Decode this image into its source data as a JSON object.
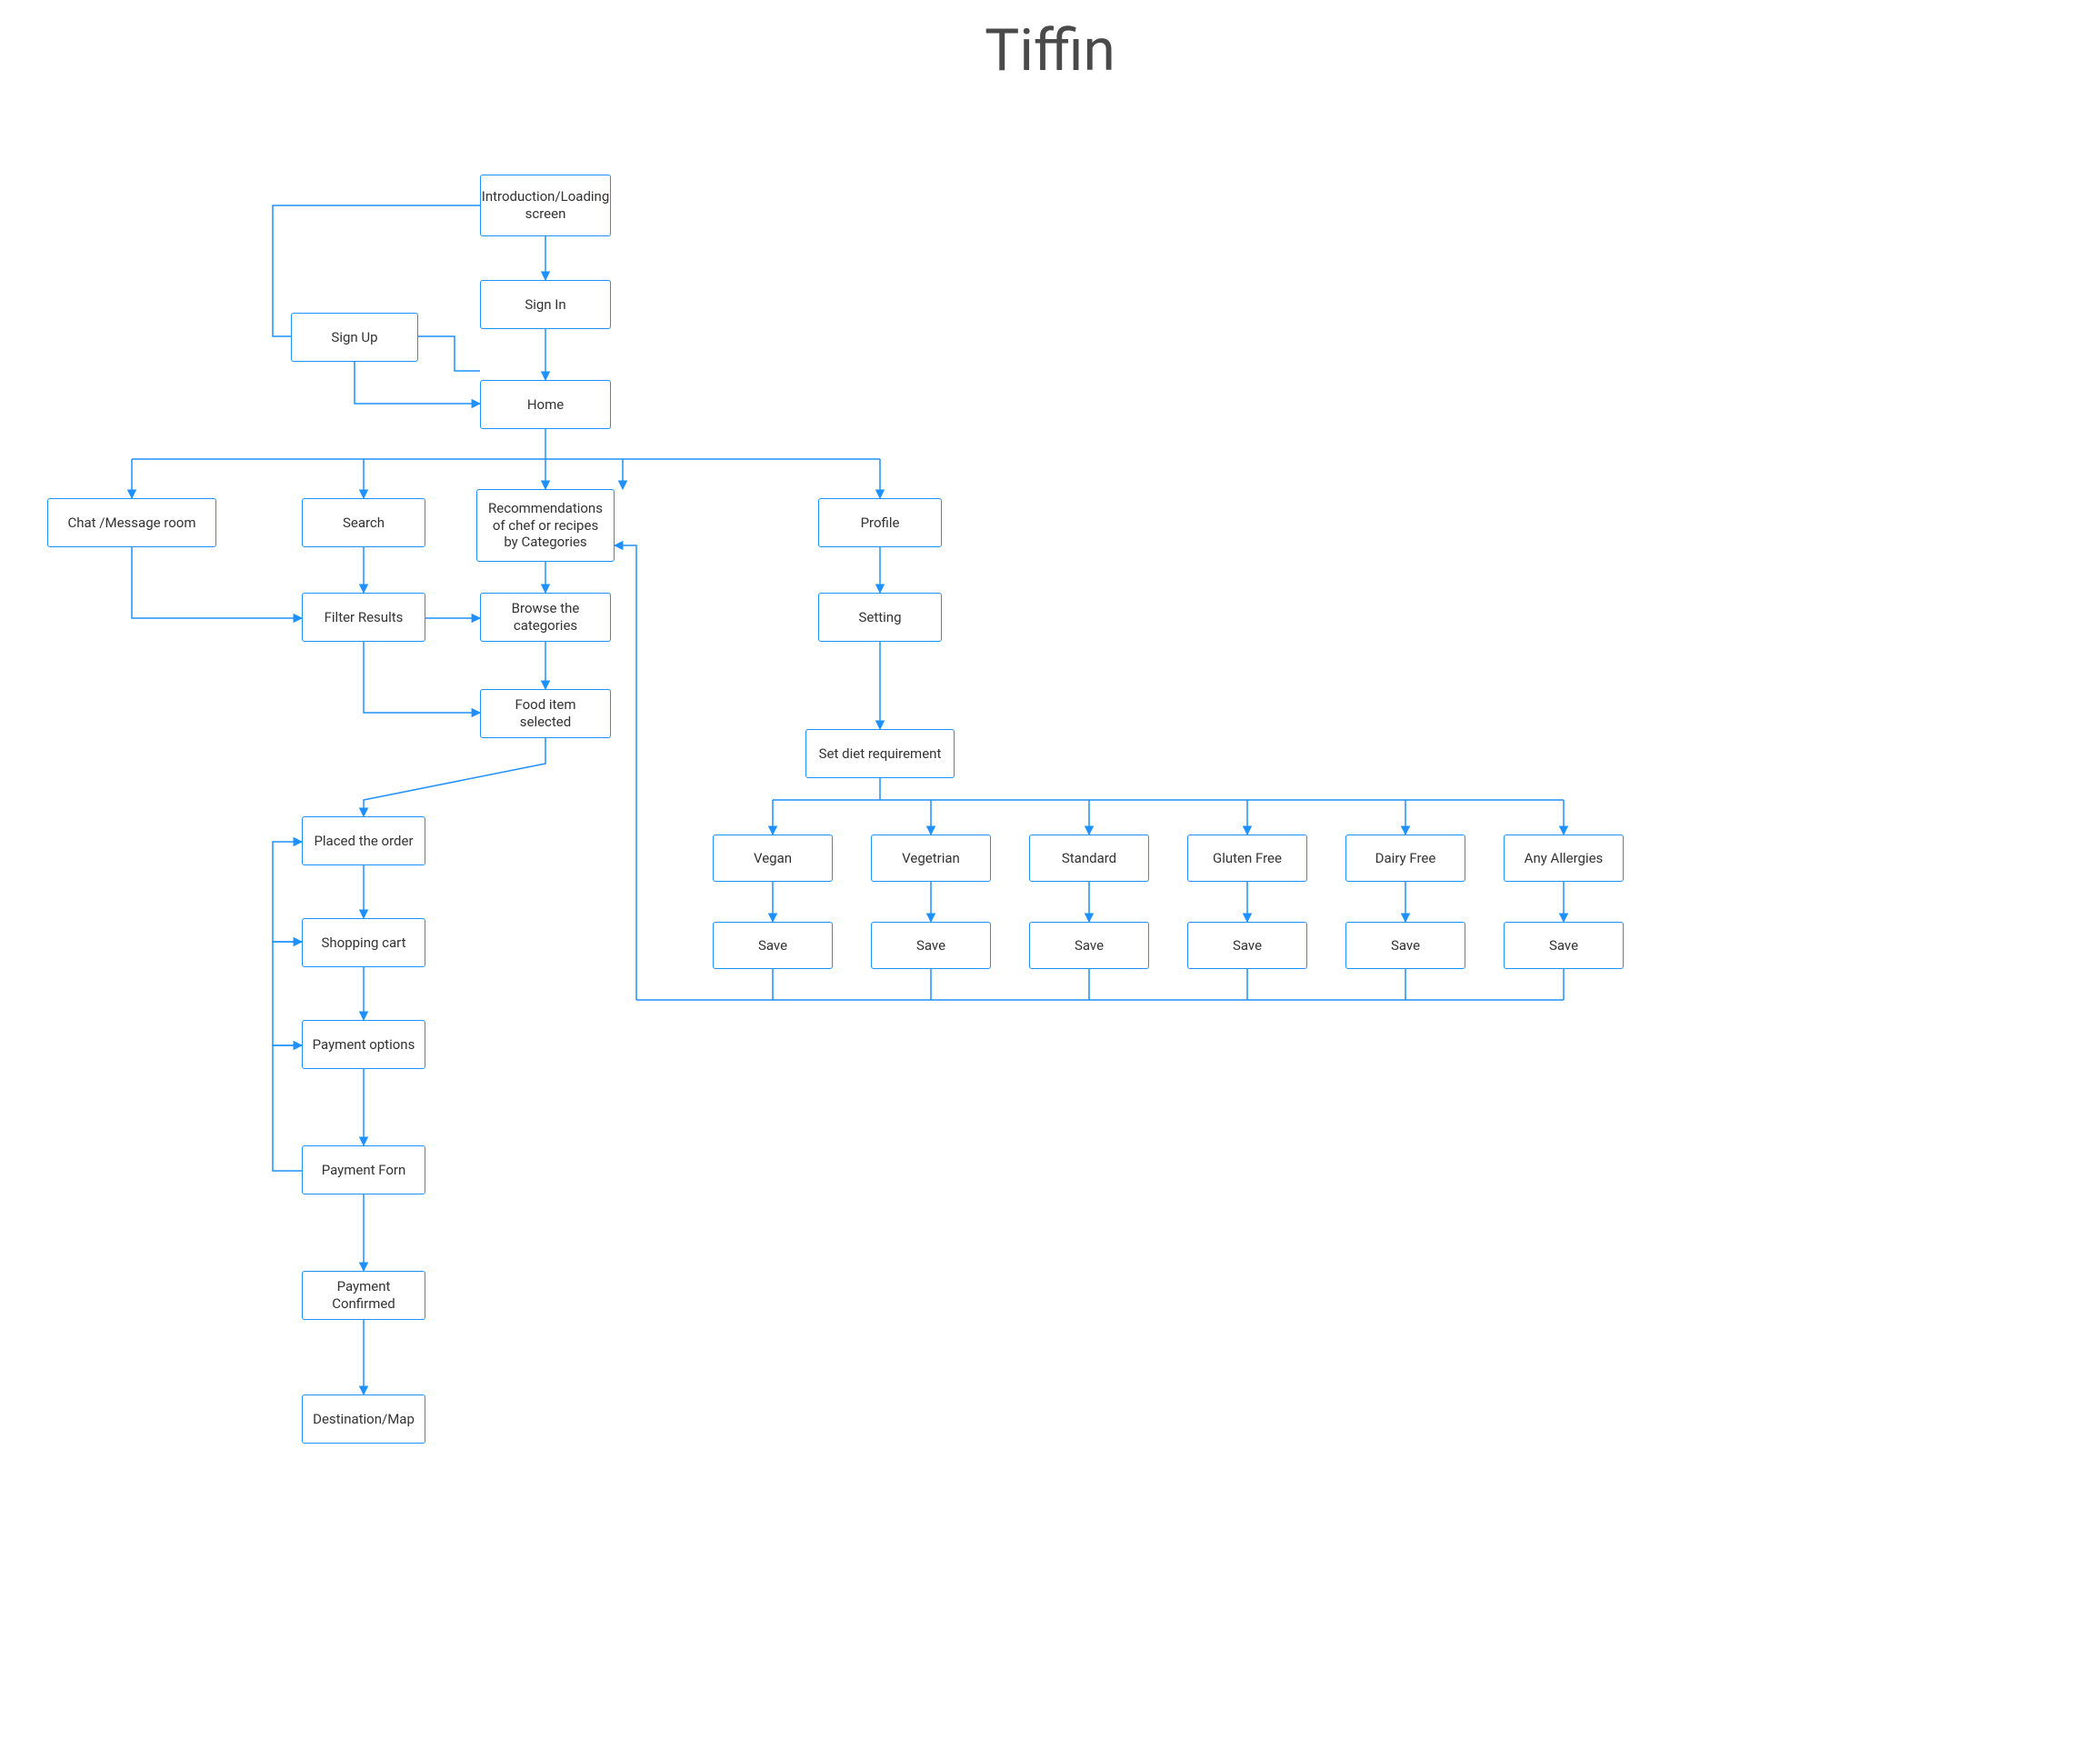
{
  "title": "Tiffin",
  "colors": {
    "node_border": "#1e90ff",
    "connector": "#1e90ff",
    "title": "#4a4a4a"
  },
  "nodes": {
    "intro": "Introduction/Loading screen",
    "signin": "Sign In",
    "signup": "Sign Up",
    "home": "Home",
    "chat": "Chat /Message room",
    "search": "Search",
    "recs": "Recommendations of chef or recipes by Categories",
    "profile": "Profile",
    "filter": "Filter Results",
    "browse": "Browse the categories",
    "setting": "Setting",
    "fooditem": "Food item selected",
    "placed": "Placed the order",
    "cart": "Shopping cart",
    "payopt": "Payment options",
    "payform": "Payment Forn",
    "payconf": "Payment Confirmed",
    "dest": "Destination/Map",
    "setdiet": "Set diet requirement",
    "diet": {
      "vegan": "Vegan",
      "vegetrian": "Vegetrian",
      "standard": "Standard",
      "glutenfree": "Gluten Free",
      "dairyfree": "Dairy Free",
      "allergies": "Any Allergies"
    },
    "save": "Save"
  }
}
